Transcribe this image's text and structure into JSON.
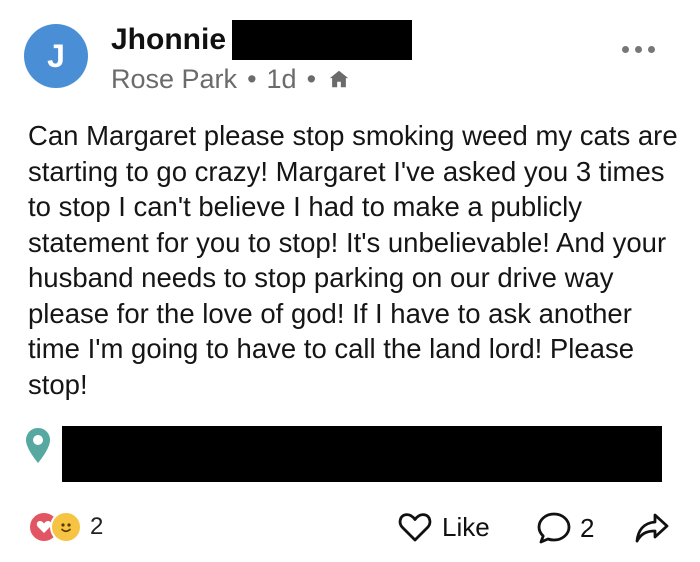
{
  "author": {
    "initial": "J",
    "name": "Jhonnie",
    "neighborhood": "Rose Park",
    "time": "1d",
    "separator": "•",
    "visibility_icon": "home-icon",
    "avatar_color": "#4a8fd6"
  },
  "menu": {
    "icon": "more-dots-icon"
  },
  "post": {
    "text": "Can Margaret please stop smoking weed my cats are starting to go crazy! Margaret I've asked you 3 times to stop I can't believe I had to make a publicly statement for you to stop! It's unbelievable! And your husband needs to stop parking on our drive way please for the love of god! If I have to ask another time I'm going to have to call the land lord! Please stop!"
  },
  "location": {
    "icon": "location-pin-icon",
    "pin_color": "#56a8a0"
  },
  "footer": {
    "reaction_count": "2",
    "like_label": "Like",
    "comment_count": "2"
  }
}
